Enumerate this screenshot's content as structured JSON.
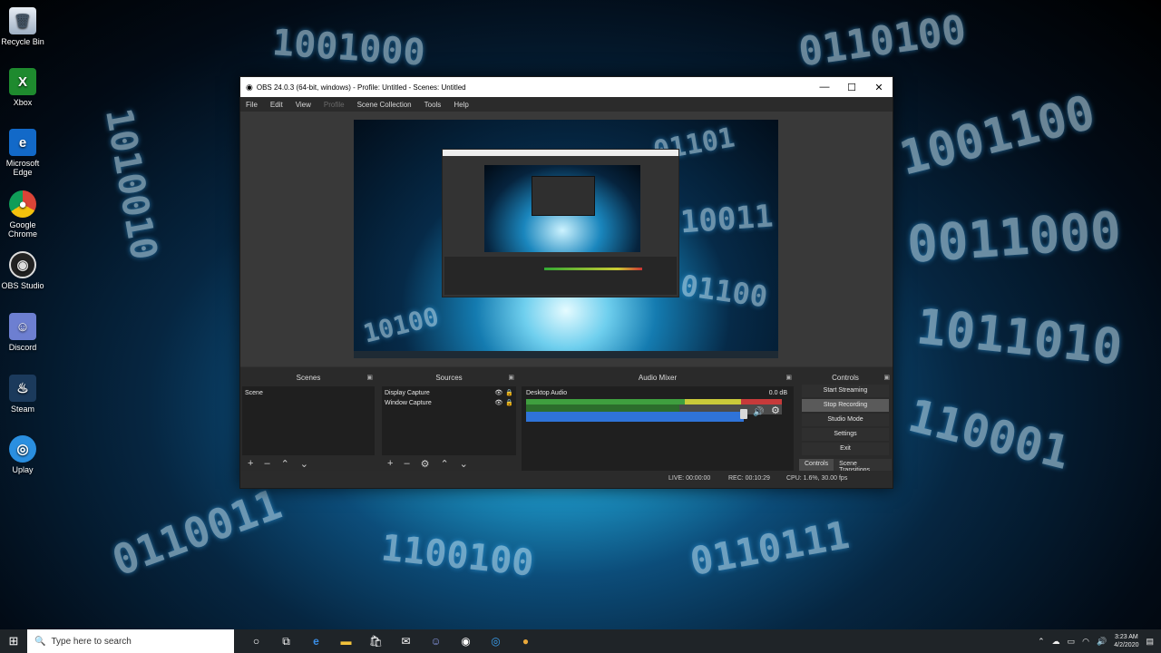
{
  "desktop": {
    "icons": [
      {
        "label": "Recycle Bin",
        "icon": "recycle-bin-icon"
      },
      {
        "label": "Xbox",
        "icon": "xbox-icon"
      },
      {
        "label": "Microsoft Edge",
        "icon": "edge-icon"
      },
      {
        "label": "Google Chrome",
        "icon": "chrome-icon"
      },
      {
        "label": "OBS Studio",
        "icon": "obs-icon"
      },
      {
        "label": "Discord",
        "icon": "discord-icon"
      },
      {
        "label": "Steam",
        "icon": "steam-icon"
      },
      {
        "label": "Uplay",
        "icon": "uplay-icon"
      }
    ]
  },
  "window": {
    "title": "OBS 24.0.3 (64-bit, windows) - Profile: Untitled - Scenes: Untitled",
    "minimize": "—",
    "maximize": "☐",
    "close": "✕"
  },
  "menu": {
    "file": "File",
    "edit": "Edit",
    "view": "View",
    "profile": "Profile",
    "scene_collection": "Scene Collection",
    "tools": "Tools",
    "help": "Help"
  },
  "docks": {
    "scenes": {
      "title": "Scenes",
      "items": [
        "Scene"
      ]
    },
    "sources": {
      "title": "Sources",
      "items": [
        "Display Capture",
        "Window Capture"
      ]
    },
    "mixer": {
      "title": "Audio Mixer",
      "track": "Desktop Audio",
      "db": "0.0 dB"
    },
    "controls": {
      "title": "Controls",
      "start_streaming": "Start Streaming",
      "stop_recording": "Stop Recording",
      "studio_mode": "Studio Mode",
      "settings": "Settings",
      "exit": "Exit",
      "tab_controls": "Controls",
      "tab_transitions": "Scene Transitions"
    }
  },
  "status": {
    "live": "LIVE: 00:00:00",
    "rec": "REC: 00:10:29",
    "cpu": "CPU: 1.6%, 30.00 fps"
  },
  "taskbar": {
    "search_placeholder": "Type here to search",
    "time": "3:23 AM",
    "date": "4/2/2020"
  }
}
